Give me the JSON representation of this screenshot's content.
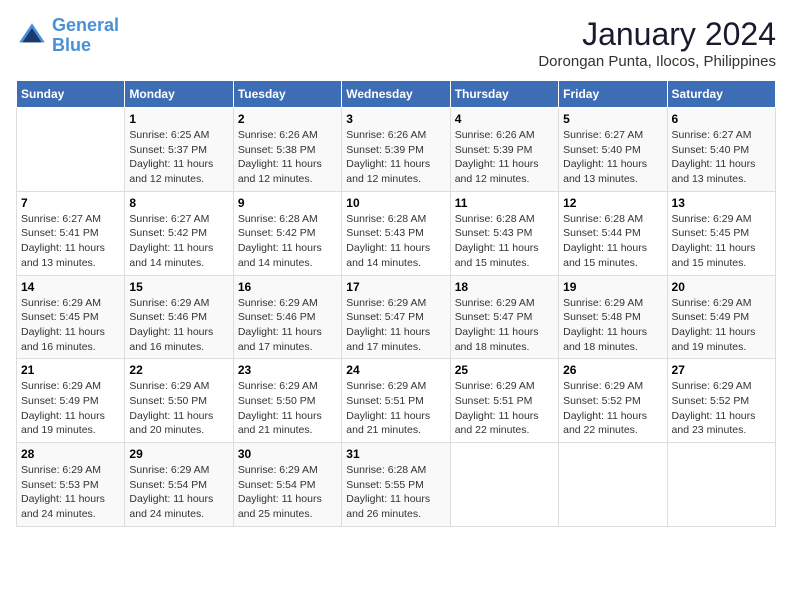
{
  "logo": {
    "line1": "General",
    "line2": "Blue"
  },
  "title": "January 2024",
  "location": "Dorongan Punta, Ilocos, Philippines",
  "days_of_week": [
    "Sunday",
    "Monday",
    "Tuesday",
    "Wednesday",
    "Thursday",
    "Friday",
    "Saturday"
  ],
  "weeks": [
    [
      {
        "day": "",
        "info": ""
      },
      {
        "day": "1",
        "info": "Sunrise: 6:25 AM\nSunset: 5:37 PM\nDaylight: 11 hours\nand 12 minutes."
      },
      {
        "day": "2",
        "info": "Sunrise: 6:26 AM\nSunset: 5:38 PM\nDaylight: 11 hours\nand 12 minutes."
      },
      {
        "day": "3",
        "info": "Sunrise: 6:26 AM\nSunset: 5:39 PM\nDaylight: 11 hours\nand 12 minutes."
      },
      {
        "day": "4",
        "info": "Sunrise: 6:26 AM\nSunset: 5:39 PM\nDaylight: 11 hours\nand 12 minutes."
      },
      {
        "day": "5",
        "info": "Sunrise: 6:27 AM\nSunset: 5:40 PM\nDaylight: 11 hours\nand 13 minutes."
      },
      {
        "day": "6",
        "info": "Sunrise: 6:27 AM\nSunset: 5:40 PM\nDaylight: 11 hours\nand 13 minutes."
      }
    ],
    [
      {
        "day": "7",
        "info": "Sunrise: 6:27 AM\nSunset: 5:41 PM\nDaylight: 11 hours\nand 13 minutes."
      },
      {
        "day": "8",
        "info": "Sunrise: 6:27 AM\nSunset: 5:42 PM\nDaylight: 11 hours\nand 14 minutes."
      },
      {
        "day": "9",
        "info": "Sunrise: 6:28 AM\nSunset: 5:42 PM\nDaylight: 11 hours\nand 14 minutes."
      },
      {
        "day": "10",
        "info": "Sunrise: 6:28 AM\nSunset: 5:43 PM\nDaylight: 11 hours\nand 14 minutes."
      },
      {
        "day": "11",
        "info": "Sunrise: 6:28 AM\nSunset: 5:43 PM\nDaylight: 11 hours\nand 15 minutes."
      },
      {
        "day": "12",
        "info": "Sunrise: 6:28 AM\nSunset: 5:44 PM\nDaylight: 11 hours\nand 15 minutes."
      },
      {
        "day": "13",
        "info": "Sunrise: 6:29 AM\nSunset: 5:45 PM\nDaylight: 11 hours\nand 15 minutes."
      }
    ],
    [
      {
        "day": "14",
        "info": "Sunrise: 6:29 AM\nSunset: 5:45 PM\nDaylight: 11 hours\nand 16 minutes."
      },
      {
        "day": "15",
        "info": "Sunrise: 6:29 AM\nSunset: 5:46 PM\nDaylight: 11 hours\nand 16 minutes."
      },
      {
        "day": "16",
        "info": "Sunrise: 6:29 AM\nSunset: 5:46 PM\nDaylight: 11 hours\nand 17 minutes."
      },
      {
        "day": "17",
        "info": "Sunrise: 6:29 AM\nSunset: 5:47 PM\nDaylight: 11 hours\nand 17 minutes."
      },
      {
        "day": "18",
        "info": "Sunrise: 6:29 AM\nSunset: 5:47 PM\nDaylight: 11 hours\nand 18 minutes."
      },
      {
        "day": "19",
        "info": "Sunrise: 6:29 AM\nSunset: 5:48 PM\nDaylight: 11 hours\nand 18 minutes."
      },
      {
        "day": "20",
        "info": "Sunrise: 6:29 AM\nSunset: 5:49 PM\nDaylight: 11 hours\nand 19 minutes."
      }
    ],
    [
      {
        "day": "21",
        "info": "Sunrise: 6:29 AM\nSunset: 5:49 PM\nDaylight: 11 hours\nand 19 minutes."
      },
      {
        "day": "22",
        "info": "Sunrise: 6:29 AM\nSunset: 5:50 PM\nDaylight: 11 hours\nand 20 minutes."
      },
      {
        "day": "23",
        "info": "Sunrise: 6:29 AM\nSunset: 5:50 PM\nDaylight: 11 hours\nand 21 minutes."
      },
      {
        "day": "24",
        "info": "Sunrise: 6:29 AM\nSunset: 5:51 PM\nDaylight: 11 hours\nand 21 minutes."
      },
      {
        "day": "25",
        "info": "Sunrise: 6:29 AM\nSunset: 5:51 PM\nDaylight: 11 hours\nand 22 minutes."
      },
      {
        "day": "26",
        "info": "Sunrise: 6:29 AM\nSunset: 5:52 PM\nDaylight: 11 hours\nand 22 minutes."
      },
      {
        "day": "27",
        "info": "Sunrise: 6:29 AM\nSunset: 5:52 PM\nDaylight: 11 hours\nand 23 minutes."
      }
    ],
    [
      {
        "day": "28",
        "info": "Sunrise: 6:29 AM\nSunset: 5:53 PM\nDaylight: 11 hours\nand 24 minutes."
      },
      {
        "day": "29",
        "info": "Sunrise: 6:29 AM\nSunset: 5:54 PM\nDaylight: 11 hours\nand 24 minutes."
      },
      {
        "day": "30",
        "info": "Sunrise: 6:29 AM\nSunset: 5:54 PM\nDaylight: 11 hours\nand 25 minutes."
      },
      {
        "day": "31",
        "info": "Sunrise: 6:28 AM\nSunset: 5:55 PM\nDaylight: 11 hours\nand 26 minutes."
      },
      {
        "day": "",
        "info": ""
      },
      {
        "day": "",
        "info": ""
      },
      {
        "day": "",
        "info": ""
      }
    ]
  ]
}
